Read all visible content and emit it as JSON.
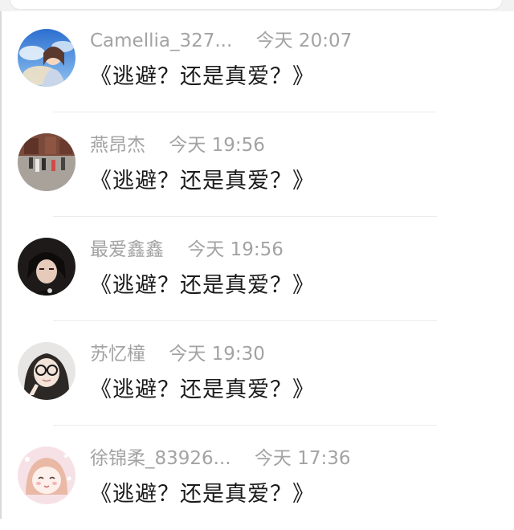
{
  "comments": [
    {
      "username": "Camellia_327...",
      "time": "今天 20:07",
      "text": "《逃避？还是真爱？》",
      "avatar": "sky-girl-avatar"
    },
    {
      "username": "燕昂杰",
      "time": "今天 19:56",
      "text": "《逃避？还是真爱？》",
      "avatar": "street-scene-avatar"
    },
    {
      "username": "最爱鑫鑫",
      "time": "今天 19:56",
      "text": "《逃避？还是真爱？》",
      "avatar": "dark-portrait-avatar"
    },
    {
      "username": "苏忆橦",
      "time": "今天 19:30",
      "text": "《逃避？还是真爱？》",
      "avatar": "glasses-girl-avatar"
    },
    {
      "username": "徐锦柔_83926...",
      "time": "今天 17:36",
      "text": "《逃避？还是真爱？》",
      "avatar": "cartoon-girl-avatar"
    }
  ],
  "colors": {
    "meta": "#a3a3a3",
    "text": "#1a1a1a",
    "divider": "#ececec"
  }
}
